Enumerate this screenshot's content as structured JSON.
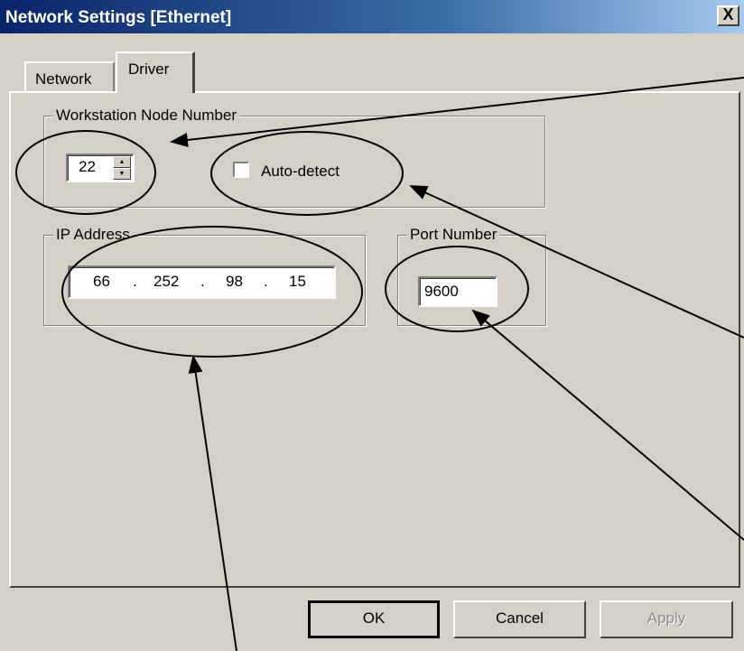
{
  "window": {
    "title": "Network Settings [Ethernet]",
    "close_glyph": "X"
  },
  "tabs": [
    {
      "label": "Network"
    },
    {
      "label": "Driver",
      "selected": true
    }
  ],
  "workstation": {
    "label": "Workstation Node Number",
    "node_number": "22",
    "auto_detect_label": "Auto-detect",
    "auto_detect_checked": false
  },
  "ip": {
    "label": "IP Address",
    "octets": [
      "66",
      "252",
      "98",
      "15"
    ],
    "separator": "."
  },
  "port": {
    "label": "Port Number",
    "value": "9600"
  },
  "buttons": {
    "ok": "OK",
    "cancel": "Cancel",
    "apply": "Apply",
    "apply_enabled": false
  },
  "icons": {
    "close": "close-icon",
    "spin_up": "spin-up-icon",
    "spin_down": "spin-down-icon"
  },
  "colors": {
    "titlebar_start": "#0a246a",
    "titlebar_end": "#a6caf0",
    "face": "#d4d0c8"
  }
}
